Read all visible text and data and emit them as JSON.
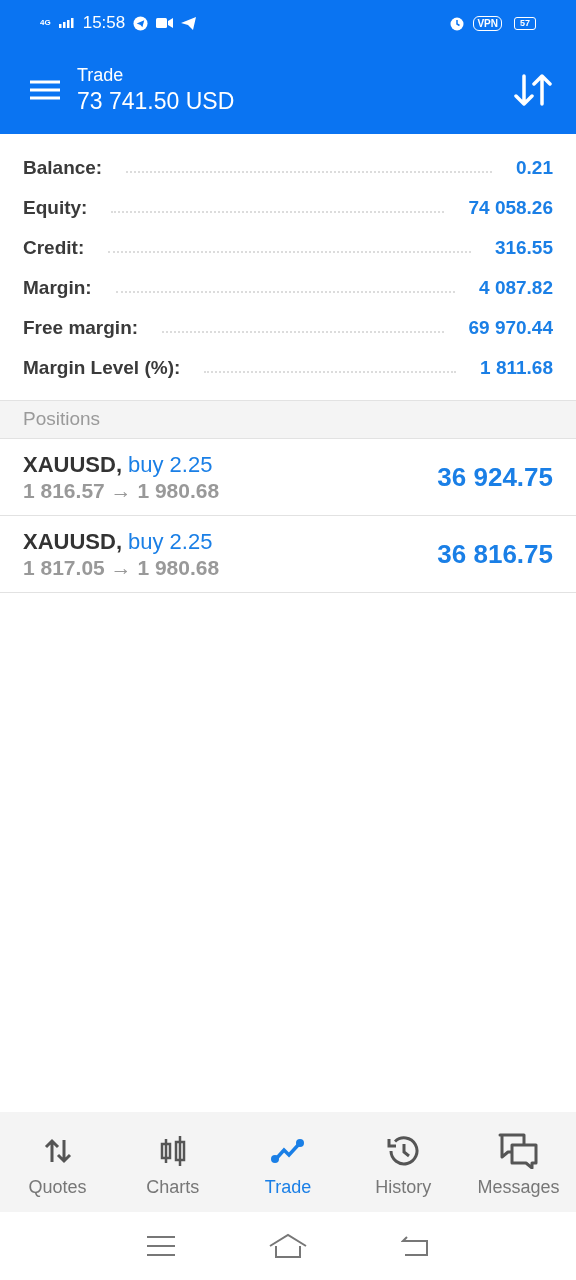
{
  "status_bar": {
    "time": "15:58",
    "network": "4G",
    "vpn": "VPN",
    "battery": "57"
  },
  "header": {
    "title": "Trade",
    "balance": "73 741.50 USD"
  },
  "summary": [
    {
      "label": "Balance:",
      "value": "0.21"
    },
    {
      "label": "Equity:",
      "value": "74 058.26"
    },
    {
      "label": "Credit:",
      "value": "316.55"
    },
    {
      "label": "Margin:",
      "value": "4 087.82"
    },
    {
      "label": "Free margin:",
      "value": "69 970.44"
    },
    {
      "label": "Margin Level (%):",
      "value": "1 811.68"
    }
  ],
  "positions": {
    "title": "Positions",
    "rows": [
      {
        "symbol": "XAUUSD,",
        "order": "buy 2.25",
        "prices": "1 816.57 → 1 980.68",
        "profit": "36 924.75"
      },
      {
        "symbol": "XAUUSD,",
        "order": "buy 2.25",
        "prices": "1 817.05 → 1 980.68",
        "profit": "36 816.75"
      }
    ]
  },
  "tabs": [
    {
      "label": "Quotes",
      "selected": false
    },
    {
      "label": "Charts",
      "selected": false
    },
    {
      "label": "Trade",
      "selected": true
    },
    {
      "label": "History",
      "selected": false
    },
    {
      "label": "Messages",
      "selected": false
    }
  ]
}
